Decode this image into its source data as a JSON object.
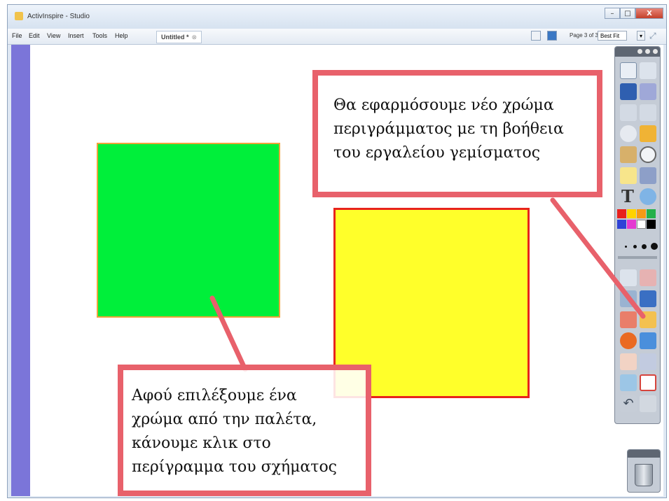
{
  "window": {
    "title": "ActivInspire - Studio",
    "controls": {
      "minimize": "–",
      "maximize": "□",
      "close": "X"
    }
  },
  "menu": {
    "items": [
      "File",
      "Edit",
      "View",
      "Insert",
      "Tools",
      "Help"
    ],
    "doc_tab": "Untitled *",
    "page_indicator": "Page 3 of 3",
    "zoom": "Best Fit"
  },
  "canvas": {
    "left_bar_color": "#7b75d9",
    "shapes": [
      {
        "name": "green-square",
        "fill": "#00ef3a",
        "outline": "#f0a33a"
      },
      {
        "name": "yellow-square",
        "fill": "#ffff2a",
        "outline": "#e8241c"
      }
    ]
  },
  "callouts": {
    "top": {
      "lines": [
        "Θα εφαρμόσουμε νέο χρώμα",
        "περιγράμματος με τη βοήθεια",
        "του εργαλείου γεμίσματος"
      ]
    },
    "bottom": {
      "lines": [
        "Αφού επιλέξουμε ένα",
        "χρώμα από την παλέτα,",
        "κάνουμε κλικ στο",
        "περίγραμμα του σχήματος"
      ]
    },
    "border_color": "#e8616b"
  },
  "toolbox": {
    "text_tool": "T",
    "palette": [
      "#e8201c",
      "#ffd200",
      "#f59a16",
      "#24b04a",
      "#2e42d6",
      "#e43ad1",
      "#ffffff",
      "#000000"
    ]
  }
}
